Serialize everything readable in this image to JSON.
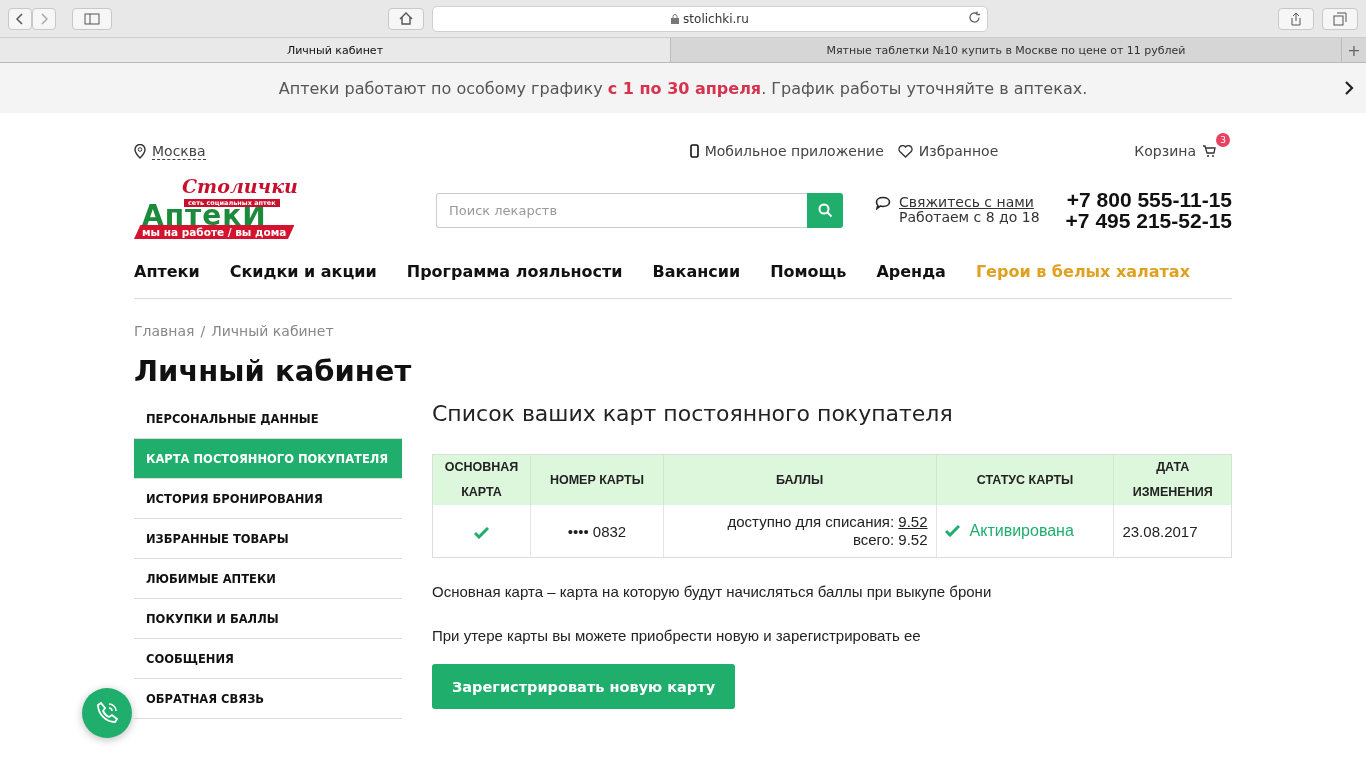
{
  "browser": {
    "url": "stolichki.ru",
    "tabs": [
      {
        "title": "Личный кабинет",
        "selected": true
      },
      {
        "title": "Мятные таблетки №10 купить в Москве по цене от 11 рублей",
        "selected": false
      }
    ],
    "new_tab": "+"
  },
  "banner": {
    "parts": [
      {
        "kind": "plain",
        "text": "Аптеки работают по особому графику "
      },
      {
        "kind": "accent",
        "text": "с 1 по 30 апреля"
      },
      {
        "kind": "plain",
        "text": ". График работы уточняйте в аптеках."
      }
    ]
  },
  "header": {
    "city": "Москва",
    "mobile_app": "Мобильное приложение",
    "favorites": "Избранное",
    "cart": "Корзина",
    "cart_count": "3",
    "logo": {
      "script": "Столички",
      "tagline": "сеть социальных аптек",
      "name": "АптекИ",
      "slogan": "мы на работе / вы дома"
    },
    "search": {
      "placeholder": "Поиск лекарств"
    },
    "contact_link": "Свяжитесь с нами",
    "hours": "Работаем с 8 до 18",
    "phones": [
      "+7 800 555-11-15",
      "+7 495 215-52-15"
    ]
  },
  "nav": [
    {
      "label": "Аптеки",
      "highlighted": false
    },
    {
      "label": "Скидки и акции",
      "highlighted": false
    },
    {
      "label": "Программа лояльности",
      "highlighted": false
    },
    {
      "label": "Вакансии",
      "highlighted": false
    },
    {
      "label": "Помощь",
      "highlighted": false
    },
    {
      "label": "Аренда",
      "highlighted": false
    },
    {
      "label": "Герои в белых халатах",
      "highlighted": true
    }
  ],
  "breadcrumbs": [
    "Главная",
    "Личный кабинет"
  ],
  "breadcrumb_separator": "/",
  "title": "Личный кабинет",
  "sidebar": [
    {
      "label": "ПЕРСОНАЛЬНЫЕ ДАННЫЕ",
      "selected": false
    },
    {
      "label": "КАРТА ПОСТОЯННОГО ПОКУПАТЕЛЯ",
      "selected": true
    },
    {
      "label": "ИСТОРИЯ БРОНИРОВАНИЯ",
      "selected": false
    },
    {
      "label": "ИЗБРАННЫЕ ТОВАРЫ",
      "selected": false
    },
    {
      "label": "ЛЮБИМЫЕ АПТЕКИ",
      "selected": false
    },
    {
      "label": "ПОКУПКИ И БАЛЛЫ",
      "selected": false
    },
    {
      "label": "СООБЩЕНИЯ",
      "selected": false
    },
    {
      "label": "ОБРАТНАЯ СВЯЗЬ",
      "selected": false
    }
  ],
  "cards": {
    "heading": "Список ваших карт постоянного покупателя",
    "columns": [
      "ОСНОВНАЯ КАРТА",
      "НОМЕР КАРТЫ",
      "БАЛЛЫ",
      "СТАТУС КАРТЫ",
      "ДАТА ИЗМЕНЕНИЯ"
    ],
    "rows": [
      {
        "main": true,
        "number": "•••• 0832",
        "available_label": "доступно для списания:",
        "available": "9.52",
        "total": "всего: 9.52",
        "status": "Активирована",
        "active": true,
        "date": "23.08.2017"
      }
    ]
  },
  "notes": [
    "Основная карта – карта на которую будут начисляться баллы при выкупе брони",
    "При утере карты вы можете приобрести новую и зарегистрировать ее"
  ],
  "register_button": "Зарегистрировать новую карту"
}
